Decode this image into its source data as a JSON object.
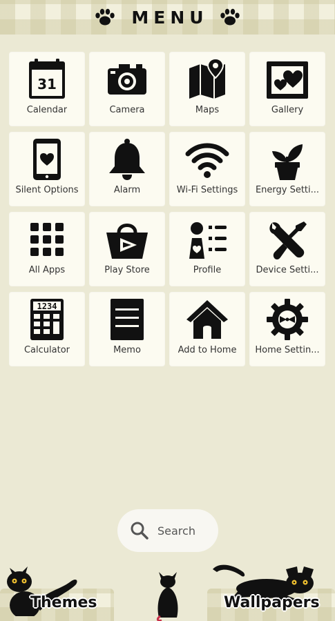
{
  "header": {
    "title": "MENU",
    "left_icon": "paw-icon",
    "right_icon": "paw-icon"
  },
  "calendar_day": "31",
  "calculator_digits": "1234",
  "apps": [
    {
      "label": "Calendar",
      "icon": "calendar-icon"
    },
    {
      "label": "Camera",
      "icon": "camera-icon"
    },
    {
      "label": "Maps",
      "icon": "map-icon"
    },
    {
      "label": "Gallery",
      "icon": "gallery-icon"
    },
    {
      "label": "Silent Options",
      "icon": "silent-phone-icon"
    },
    {
      "label": "Alarm",
      "icon": "bell-icon"
    },
    {
      "label": "Wi-Fi Settings",
      "icon": "wifi-icon"
    },
    {
      "label": "Energy Setti...",
      "icon": "plant-icon"
    },
    {
      "label": "All Apps",
      "icon": "grid-icon"
    },
    {
      "label": "Play Store",
      "icon": "shopping-bag-play-icon"
    },
    {
      "label": "Profile",
      "icon": "profile-icon"
    },
    {
      "label": "Device Setti...",
      "icon": "tools-icon"
    },
    {
      "label": "Calculator",
      "icon": "calculator-icon"
    },
    {
      "label": "Memo",
      "icon": "memo-icon"
    },
    {
      "label": "Add to Home",
      "icon": "doghouse-icon"
    },
    {
      "label": "Home Settin...",
      "icon": "gear-bow-icon"
    }
  ],
  "search": {
    "label": "Search",
    "icon": "search-icon"
  },
  "bottom": {
    "themes_label": "Themes",
    "wallpapers_label": "Wallpapers"
  },
  "colors": {
    "background": "#ebe9d4",
    "tile": "#fcfbf1",
    "icon": "#111111",
    "cat_eyes": "#f2c230"
  }
}
